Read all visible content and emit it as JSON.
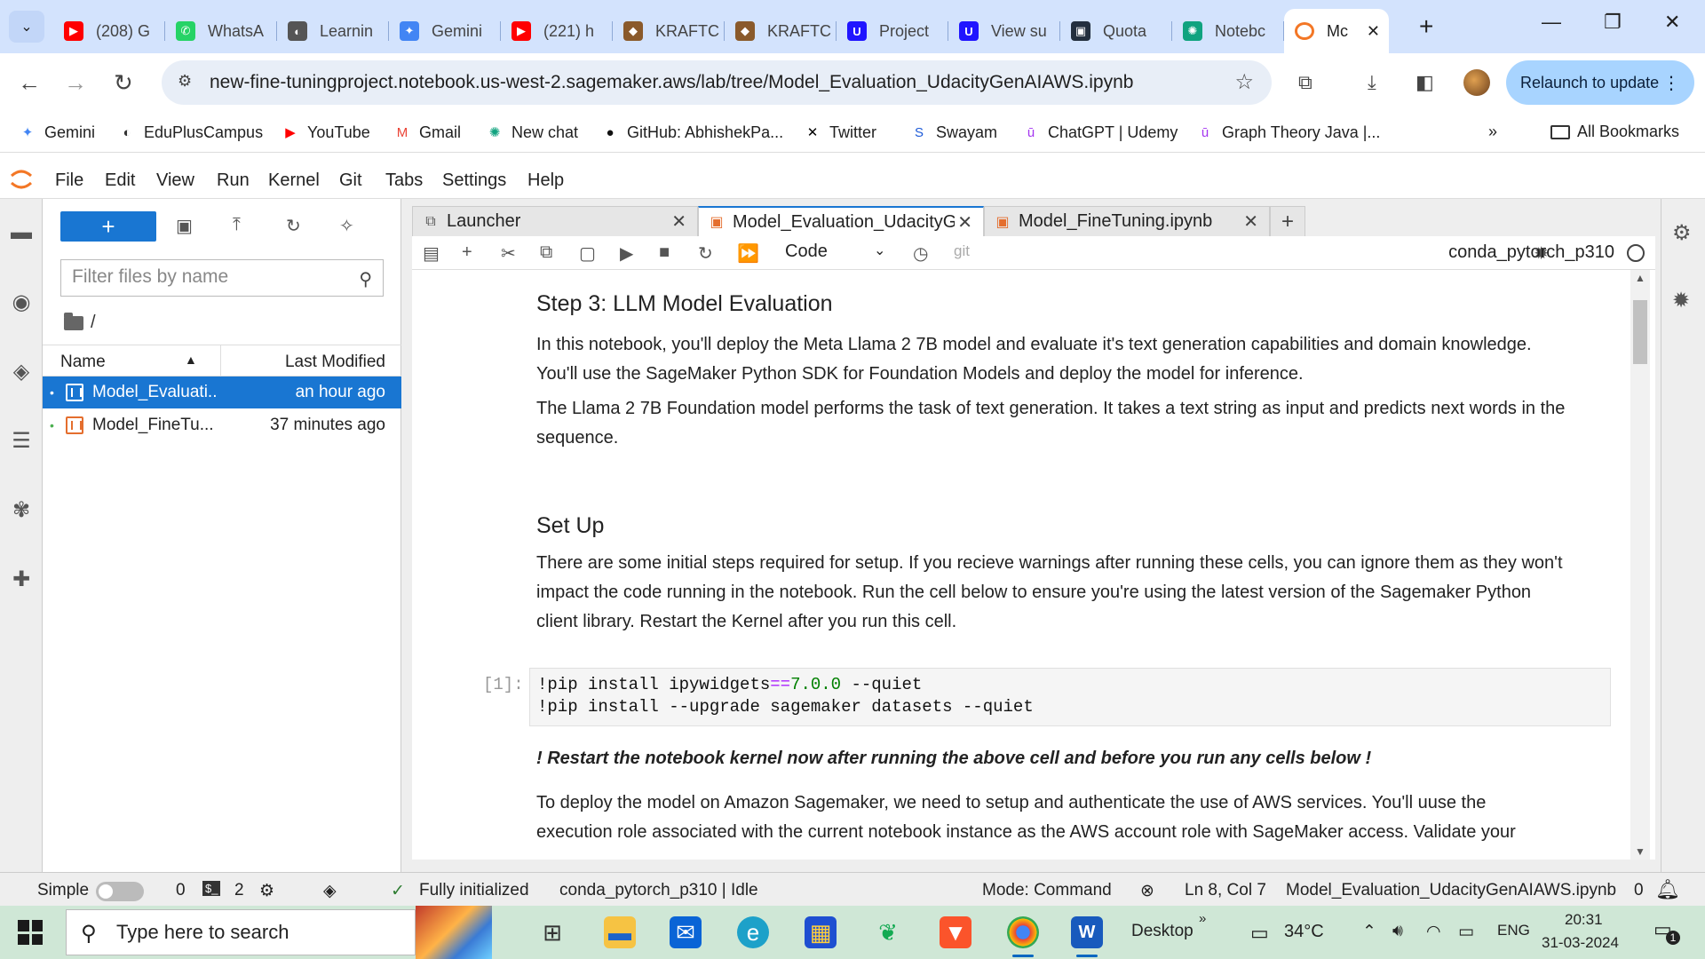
{
  "browser": {
    "tabs": [
      {
        "label": "(208) G",
        "icon": "youtube-icon",
        "color": "#ff0000",
        "glyph": "▶"
      },
      {
        "label": "WhatsA",
        "icon": "whatsapp-icon",
        "color": "#25d366",
        "glyph": "✆"
      },
      {
        "label": "Learnin",
        "icon": "globe-icon",
        "color": "#555555",
        "glyph": "◐"
      },
      {
        "label": "Gemini",
        "icon": "gemini-icon",
        "color": "#4285f4",
        "glyph": "✦"
      },
      {
        "label": "(221) h",
        "icon": "youtube-icon",
        "color": "#ff0000",
        "glyph": "▶"
      },
      {
        "label": "KRAFTC",
        "icon": "kraft-icon",
        "color": "#8a5a2b",
        "glyph": "◆"
      },
      {
        "label": "KRAFTC",
        "icon": "kraft-icon",
        "color": "#8a5a2b",
        "glyph": "◆"
      },
      {
        "label": "Project",
        "icon": "udacity-icon",
        "color": "#2015ff",
        "glyph": "U"
      },
      {
        "label": "View su",
        "icon": "udacity-icon",
        "color": "#2015ff",
        "glyph": "U"
      },
      {
        "label": "Quota",
        "icon": "aws-quota-icon",
        "color": "#232f3e",
        "glyph": "▣"
      },
      {
        "label": "Notebc",
        "icon": "chatgpt-icon",
        "color": "#10a37f",
        "glyph": "✺"
      }
    ],
    "active_tab": {
      "label": "Mc",
      "icon": "jupyter-icon",
      "color": "#f37726"
    },
    "url": "new-fine-tuningproject.notebook.us-west-2.sagemaker.aws/lab/tree/Model_Evaluation_UdacityGenAIAWS.ipynb",
    "relaunch_label": "Relaunch to update",
    "bookmarks": [
      {
        "label": "Gemini",
        "icon": "gemini-icon",
        "color": "#4285f4",
        "glyph": "✦"
      },
      {
        "label": "EduPlusCampus",
        "icon": "globe-icon",
        "color": "#333333",
        "glyph": "◐"
      },
      {
        "label": "YouTube",
        "icon": "youtube-icon",
        "color": "#ff0000",
        "glyph": "▶"
      },
      {
        "label": "Gmail",
        "icon": "gmail-icon",
        "color": "#ea4335",
        "glyph": "M"
      },
      {
        "label": "New chat",
        "icon": "chatgpt-icon",
        "color": "#10a37f",
        "glyph": "✺"
      },
      {
        "label": "GitHub: AbhishekPa...",
        "icon": "github-icon",
        "color": "#111111",
        "glyph": "●"
      },
      {
        "label": "Twitter",
        "icon": "x-icon",
        "color": "#000000",
        "glyph": "✕"
      },
      {
        "label": "Swayam",
        "icon": "swayam-icon",
        "color": "#1e5bd8",
        "glyph": "S"
      },
      {
        "label": "ChatGPT | Udemy",
        "icon": "udemy-icon",
        "color": "#a435f0",
        "glyph": "ū"
      },
      {
        "label": "Graph Theory Java |...",
        "icon": "udemy-icon",
        "color": "#a435f0",
        "glyph": "ū"
      }
    ],
    "all_bookmarks": "All Bookmarks"
  },
  "jupyter": {
    "menus": [
      "File",
      "Edit",
      "View",
      "Run",
      "Kernel",
      "Git",
      "Tabs",
      "Settings",
      "Help"
    ],
    "filebrowser": {
      "filter_placeholder": "Filter files by name",
      "path": "/",
      "col_name": "Name",
      "col_modified": "Last Modified",
      "files": [
        {
          "name": "Model_Evaluati...",
          "modified": "an hour ago",
          "selected": true
        },
        {
          "name": "Model_FineTu...",
          "modified": "37 minutes ago",
          "selected": false
        }
      ]
    },
    "doc_tabs": [
      {
        "label": "Launcher",
        "icon": "launcher-icon"
      },
      {
        "label": "Model_Evaluation_UdacityGe",
        "icon": "notebook-icon",
        "active": true
      },
      {
        "label": "Model_FineTuning.ipynb",
        "icon": "notebook-icon"
      }
    ],
    "toolbar": {
      "cell_type": "Code",
      "git_label": "git",
      "kernel": "conda_pytorch_p310"
    },
    "notebook": {
      "h_step3": "Step 3: LLM Model Evaluation",
      "p1": "In this notebook, you'll deploy the Meta Llama 2 7B model and evaluate it's text generation capabilities and domain knowledge. You'll use the SageMaker Python SDK for Foundation Models and deploy the model for inference.",
      "p2": "The Llama 2 7B Foundation model performs the task of text generation. It takes a text string as input and predicts next words in the sequence.",
      "h_setup": "Set Up",
      "p3": "There are some initial steps required for setup. If you recieve warnings after running these cells, you can ignore them as they won't impact the code running in the notebook. Run the cell below to ensure you're using the latest version of the Sagemaker Python client library. Restart the Kernel after you run this cell.",
      "cell_prompt": "[1]:",
      "code_line1": {
        "bang": "!",
        "cmd": "pip install ipywidgets",
        "op": "==",
        "ver": "7.0.0",
        "flag": " --quiet"
      },
      "code_line2": {
        "bang": "!",
        "cmd": "pip install ",
        "flag1": "--upgrade",
        "rest": " sagemaker datasets ",
        "flag2": "--quiet"
      },
      "warning": "! Restart the notebook kernel now after running the above cell and before you run any cells below !",
      "p4": "To deploy the model on Amazon Sagemaker, we need to setup and authenticate the use of AWS services. You'll uuse the execution role associated with the current notebook instance as the AWS account role with SageMaker access. Validate your"
    },
    "status": {
      "mode_simple": "Simple",
      "terminals": "0",
      "kernels": "2",
      "init": "Fully initialized",
      "kernel_status": "conda_pytorch_p310 | Idle",
      "mode": "Mode: Command",
      "position": "Ln 8, Col 7",
      "filename": "Model_Evaluation_UdacityGenAIAWS.ipynb",
      "notifications": "0"
    }
  },
  "taskbar": {
    "search_placeholder": "Type here to search",
    "desktop_label": "Desktop",
    "temperature": "34°C",
    "language": "ENG",
    "time": "20:31",
    "date": "31-03-2024",
    "notif_count": "1"
  }
}
